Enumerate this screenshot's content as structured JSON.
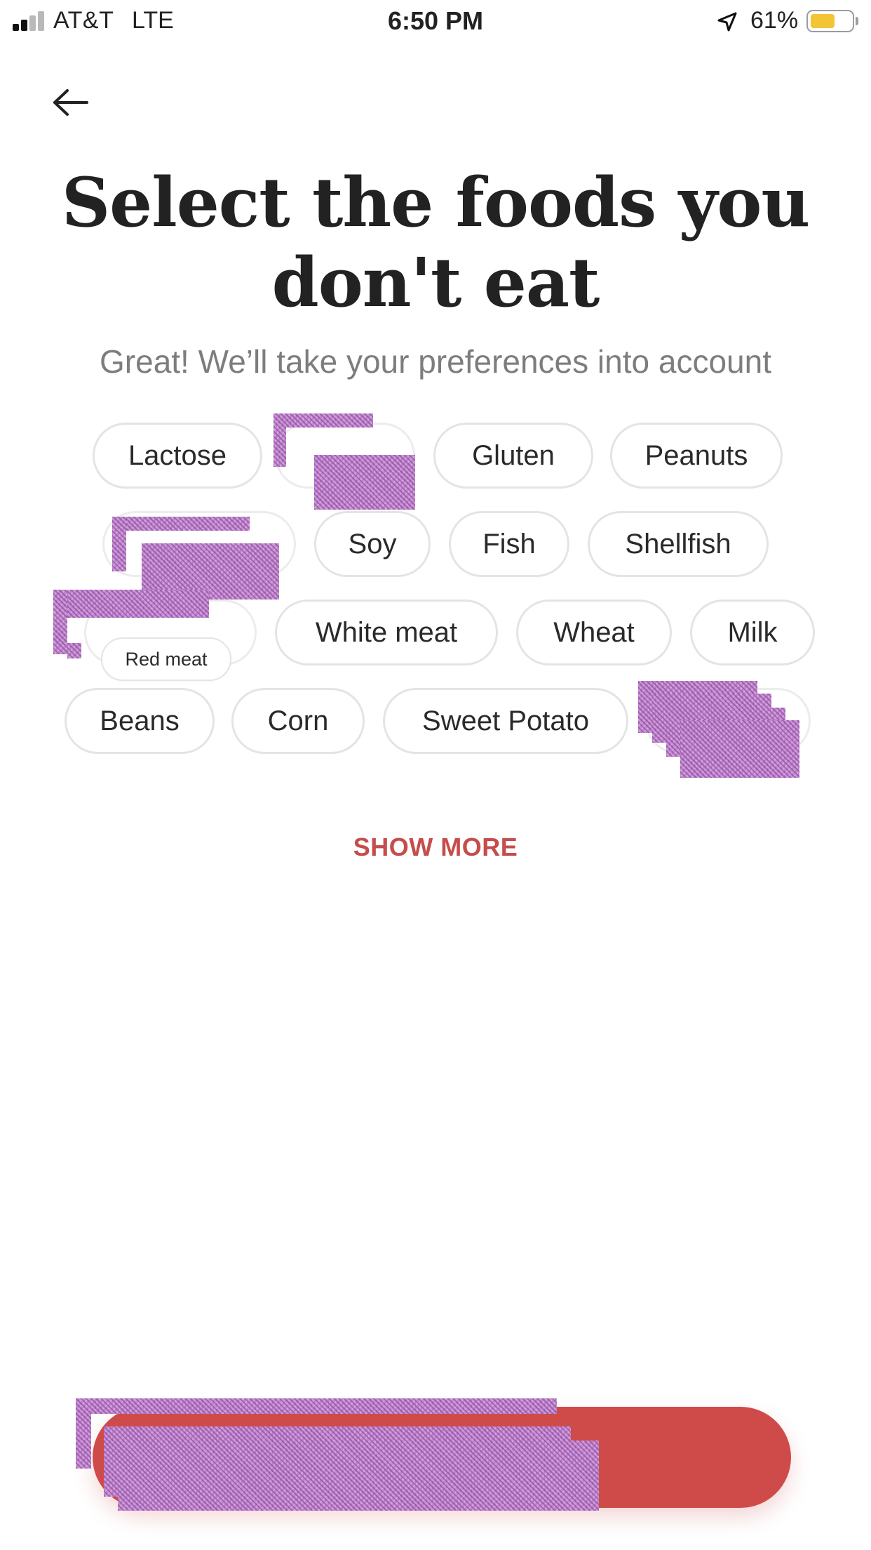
{
  "status_bar": {
    "carrier": "AT&T",
    "network": "LTE",
    "time": "6:50 PM",
    "battery_percent": "61%",
    "battery_level": 0.61,
    "battery_color": "#f3c433"
  },
  "header": {
    "back_icon": "arrow-left-icon",
    "title": "Select the foods you don't eat",
    "subtitle": "Great! We’ll take your preferences into account"
  },
  "food_options": [
    {
      "label": "Lactose"
    },
    {
      "label": ""
    },
    {
      "label": "Gluten"
    },
    {
      "label": "Peanuts"
    },
    {
      "label": ""
    },
    {
      "label": "Soy"
    },
    {
      "label": "Fish"
    },
    {
      "label": "Shellfish"
    },
    {
      "label": ""
    },
    {
      "label": "White meat"
    },
    {
      "label": "Wheat"
    },
    {
      "label": "Milk"
    },
    {
      "label": "Red meat"
    },
    {
      "label": "Beans"
    },
    {
      "label": "Corn"
    },
    {
      "label": "Sweet Potato"
    },
    {
      "label": ""
    }
  ],
  "show_more_label": "SHOW MORE",
  "cta": {
    "label": "",
    "color": "#cf4b49"
  },
  "colors": {
    "accent": "#c54d4b",
    "chip_border": "#e4e4e4",
    "subtitle": "#7d7d7d"
  }
}
